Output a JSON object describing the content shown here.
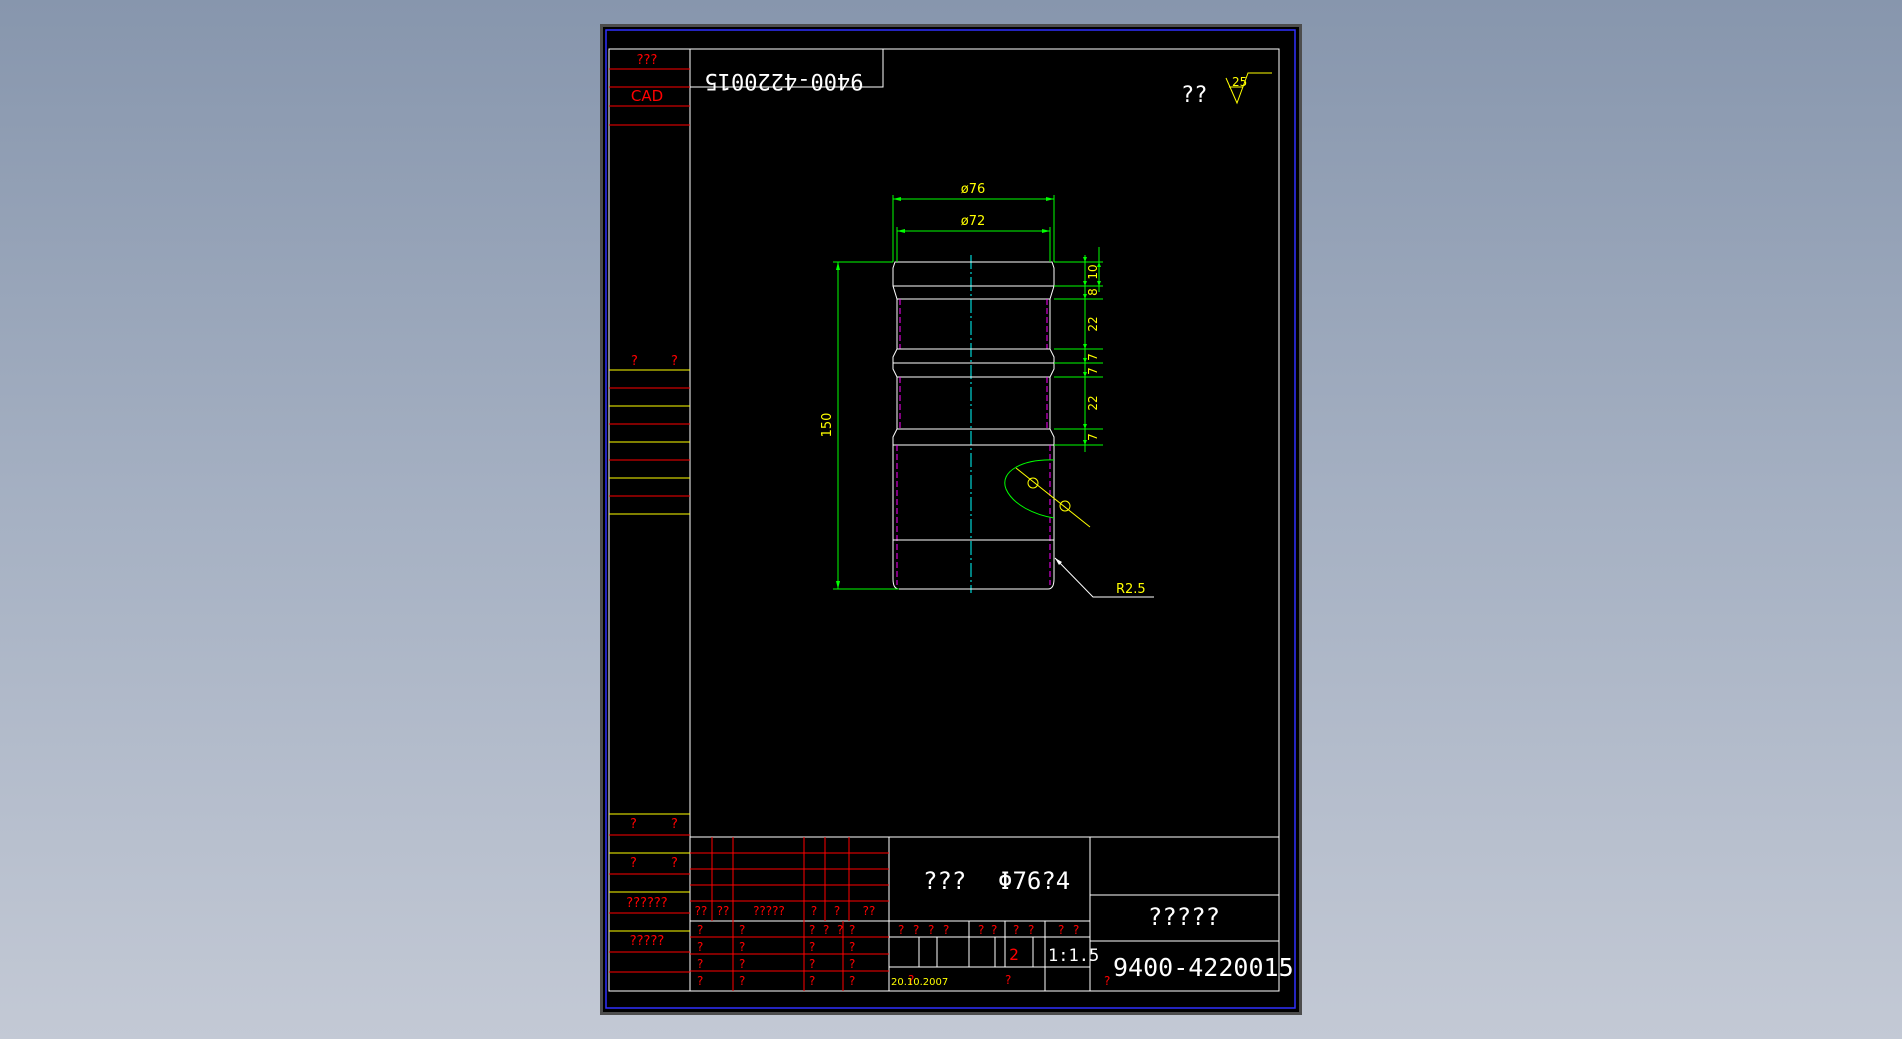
{
  "drawing": {
    "code_mirrored": "9400-4220015",
    "top_left_label": "???",
    "cad_label": "CAD",
    "roughness_prefix": "??",
    "roughness_value": "25",
    "dims": {
      "d76": "ø76",
      "d72": "ø72",
      "l150": "150",
      "v8": "8",
      "v10": "10",
      "v22a": "22",
      "v7a": "7",
      "v7b": "7",
      "v22b": "22",
      "v7c": "7",
      "r25": "R2.5"
    },
    "left_panel": {
      "mid_a": "?",
      "mid_b": "?",
      "low1_a": "?",
      "low1_b": "?",
      "low2_a": "?",
      "low2_b": "?",
      "low3": "??????",
      "low4": "?????"
    },
    "title_block": {
      "part_name": "???",
      "part_spec": "Φ76?4",
      "material": "?????",
      "drawing_number": "9400-4220015",
      "scale": "1:1.5",
      "quantity": "2",
      "date": "20.10.2007",
      "rev_headers": [
        "??",
        "??",
        "?????",
        "?",
        "?",
        "??"
      ],
      "sign_rows": [
        {
          "a": "?",
          "b": "?",
          "c": "?",
          "d": "?",
          "e": "?",
          "f": "?"
        },
        {
          "a": "?",
          "b": "?",
          "c": "?",
          "d": "?"
        },
        {
          "a": "?",
          "b": "?",
          "c": "?",
          "d": "?"
        },
        {
          "a": "?",
          "b": "?",
          "c": "?",
          "d": "?"
        }
      ],
      "attr_headers": [
        "?",
        "?",
        "?",
        "?",
        "?",
        "?",
        "?",
        "?",
        "?",
        "?"
      ],
      "after_date": "?",
      "below_qty": "?",
      "small_q": "?"
    }
  }
}
